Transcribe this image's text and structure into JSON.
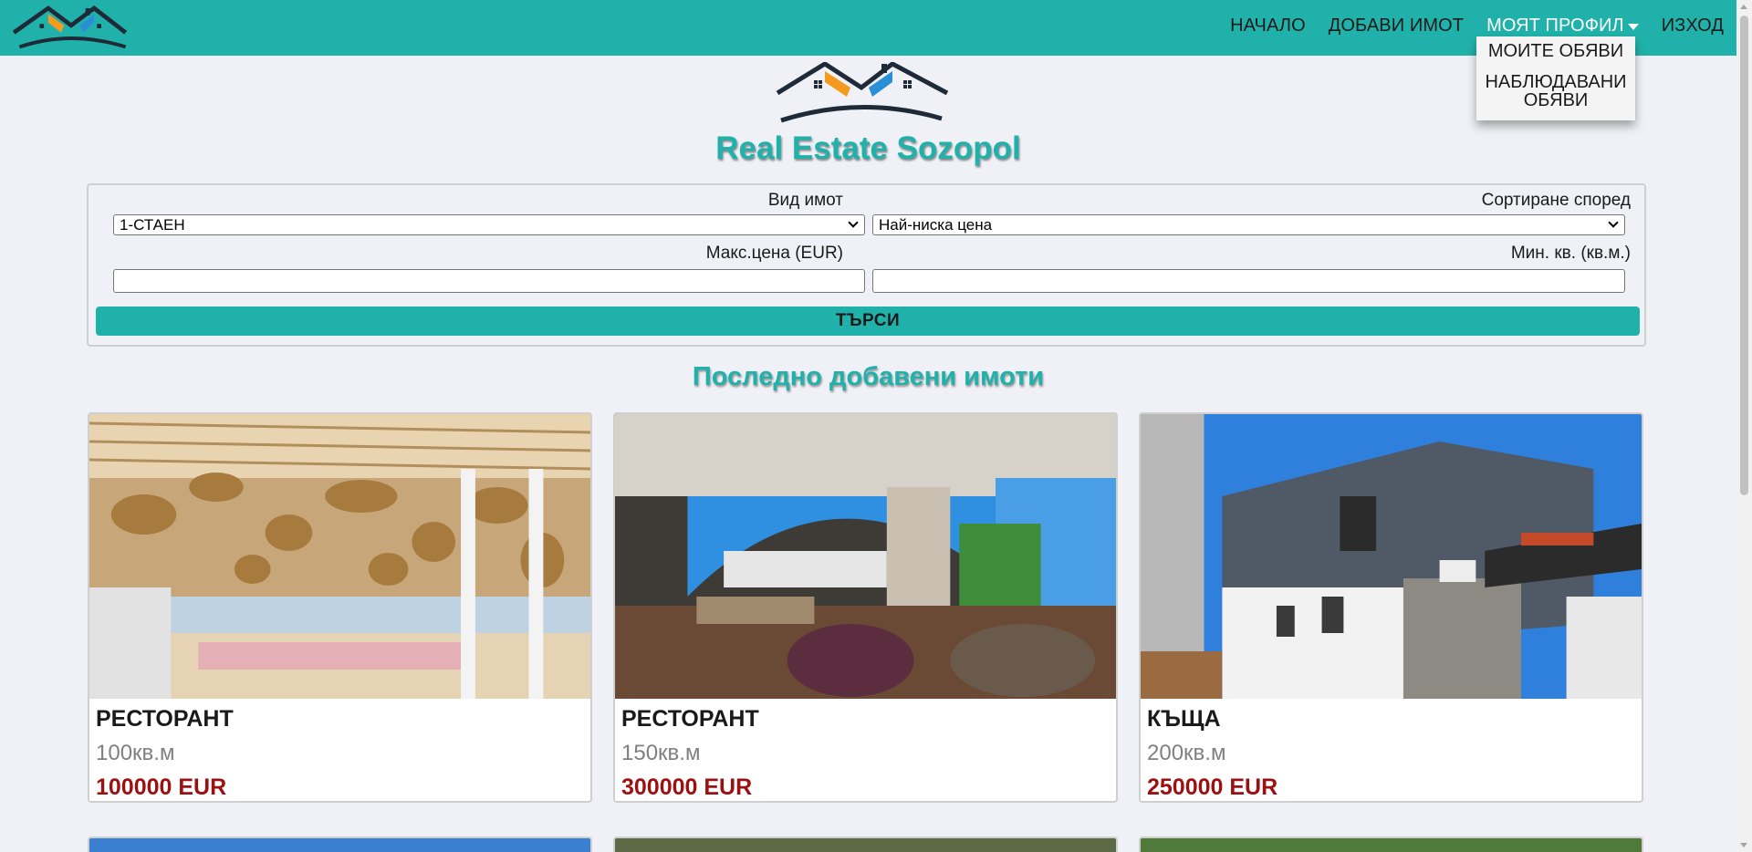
{
  "nav": {
    "links": [
      "НАЧАЛО",
      "ДОБАВИ ИМОТ",
      "МОЯТ ПРОФИЛ",
      "ИЗХОД"
    ],
    "dropdown_items": [
      "МОИТЕ ОБЯВИ",
      "НАБЛЮДАВАНИ ОБЯВИ"
    ]
  },
  "site": {
    "title": "Real Estate Sozopol"
  },
  "search": {
    "type_label": "Вид имот",
    "type_value": "1-СТАЕН",
    "sort_label": "Сортиране според",
    "sort_value": "Най-ниска цена",
    "max_price_label": "Макс.цена (EUR)",
    "max_price_value": "",
    "min_area_label": "Мин. кв. (кв.м.)",
    "min_area_value": "",
    "submit_label": "ТЪРСИ"
  },
  "latest": {
    "title": "Последно добавени имоти",
    "cards": [
      {
        "type": "РЕСТОРАНТ",
        "area": "100кв.м",
        "price": "100000 EUR"
      },
      {
        "type": "РЕСТОРАНТ",
        "area": "150кв.м",
        "price": "300000 EUR"
      },
      {
        "type": "КЪЩА",
        "area": "200кв.м",
        "price": "250000 EUR"
      }
    ]
  },
  "colors": {
    "accent": "#20b2aa",
    "price": "#9b1111",
    "background": "#f0f1f6"
  }
}
